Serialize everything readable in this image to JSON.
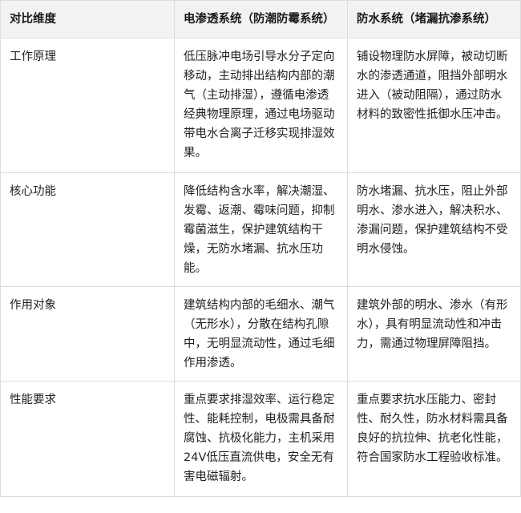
{
  "table": {
    "headers": [
      "对比维度",
      "电渗透系统（防潮防霉系统）",
      "防水系统（堵漏抗渗系统）"
    ],
    "rows": [
      {
        "dimension": "工作原理",
        "electro": "低压脉冲电场引导水分子定向移动，主动排出结构内部的潮气（主动排湿），遵循电渗透经典物理原理，通过电场驱动带电水合离子迁移实现排湿效果。",
        "waterproof": "铺设物理防水屏障，被动切断水的渗透通道，阻挡外部明水进入（被动阻隔），通过防水材料的致密性抵御水压冲击。"
      },
      {
        "dimension": "核心功能",
        "electro": "降低结构含水率，解决潮湿、发霉、返潮、霉味问题，抑制霉菌滋生，保护建筑结构干燥，无防水堵漏、抗水压功能。",
        "waterproof": "防水堵漏、抗水压，阻止外部明水、渗水进入，解决积水、渗漏问题，保护建筑结构不受明水侵蚀。"
      },
      {
        "dimension": "作用对象",
        "electro": "建筑结构内部的毛细水、潮气（无形水），分散在结构孔隙中，无明显流动性，通过毛细作用渗透。",
        "waterproof": "建筑外部的明水、渗水（有形水），具有明显流动性和冲击力，需通过物理屏障阻挡。"
      },
      {
        "dimension": "性能要求",
        "electro": "重点要求排湿效率、运行稳定性、能耗控制，电极需具备耐腐蚀、抗极化能力，主机采用24V低压直流供电，安全无有害电磁辐射。",
        "waterproof": "重点要求抗水压能力、密封性、耐久性，防水材料需具备良好的抗拉伸、抗老化性能，符合国家防水工程验收标准。"
      }
    ]
  }
}
